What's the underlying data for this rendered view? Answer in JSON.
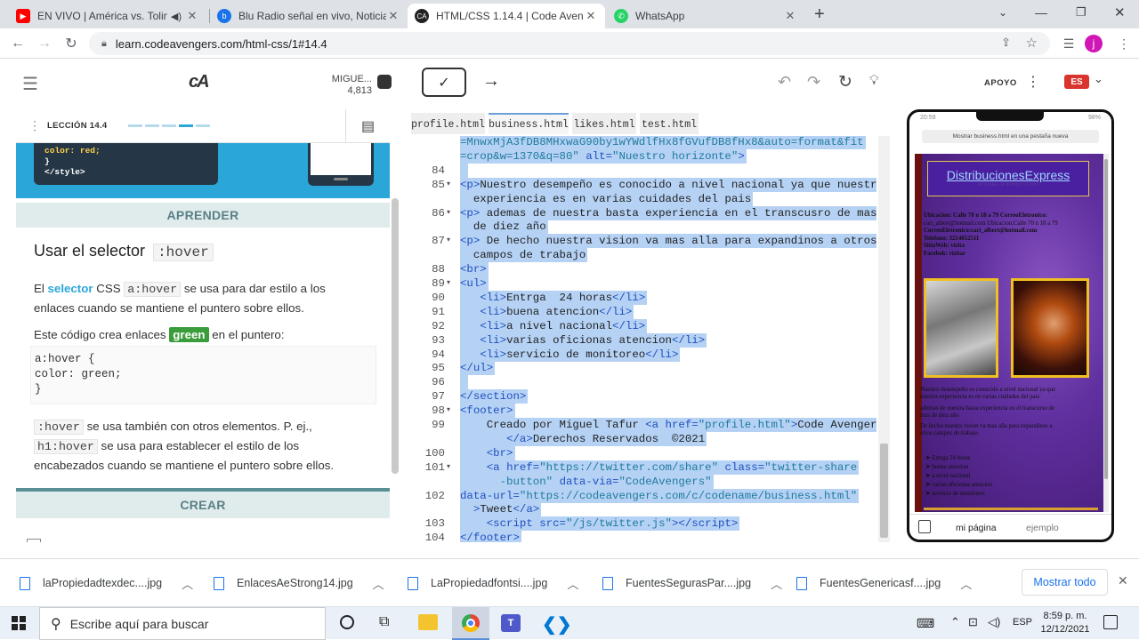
{
  "browser": {
    "tabs": [
      {
        "title": "EN VIVO | América vs. Tolima",
        "favicon": "youtube-icon",
        "color": "#ff0000"
      },
      {
        "title": "Blu Radio señal en vivo, Noticias",
        "favicon": "blu-radio-icon",
        "color": "#1a73e8"
      },
      {
        "title": "HTML/CSS 1.14.4 | Code Avengers",
        "favicon": "code-avengers-icon",
        "color": "#222222"
      },
      {
        "title": "WhatsApp",
        "favicon": "whatsapp-icon",
        "color": "#25d366"
      }
    ],
    "url": "learn.codeavengers.com/html-css/1#14.4",
    "profile_initial": "j"
  },
  "app": {
    "user_name": "MIGUE...",
    "user_points": "4,813",
    "support_label": "APOYO",
    "language": "ES"
  },
  "lesson": {
    "label": "LECCIÓN 14.4",
    "code_preview": [
      "color: red;",
      "}",
      "</style>"
    ],
    "learn_band": "APRENDER",
    "heading_text": "Usar el selector",
    "heading_code": ":hover",
    "p1": {
      "a": "El",
      "link": "selector",
      "b": "CSS",
      "code": "a:hover",
      "c": "se usa para dar estilo a los enlaces cuando se mantiene el puntero sobre ellos."
    },
    "p2": {
      "a": "Este código crea enlaces",
      "badge": "green",
      "b": "en el puntero:"
    },
    "code_block": [
      "a:hover {",
      "  color: green;",
      "}"
    ],
    "p3": {
      "code1": ":hover",
      "a": "se usa también con otros elementos. P. ej.,",
      "code2": "h1:hover",
      "b": "se usa para establecer el estilo de los encabezados cuando se mantiene el puntero sobre ellos."
    },
    "create_band": "CREAR",
    "accent_color": "#2aa6d9",
    "green_color": "#3a9c3a"
  },
  "editor": {
    "files": [
      "profile.html",
      "business.html",
      "likes.html",
      "test.html"
    ],
    "active_file": "business.html",
    "lines": [
      {
        "n": "",
        "f": "",
        "h": "<span class='st'>=MnwxMjA3fDB8MHxwaG90by1wYWdlfHx8fGVufDB8fHx8&auto=format&fit</span>"
      },
      {
        "n": "",
        "f": "",
        "h": "<span class='st'>=crop&w=1370&q=80\"</span> <span class='at'>alt=</span><span class='st'>\"Nuestro horizonte\"</span><span class='tg'>&gt;</span>"
      },
      {
        "n": "84",
        "f": "",
        "h": ""
      },
      {
        "n": "85",
        "f": "▾",
        "h": "<span class='tg'>&lt;p&gt;</span>Nuestro desempeño es conocido a nivel nacional ya que nuestra"
      },
      {
        "n": "",
        "f": "",
        "h": "  experiencia es en varias cuidades del pais"
      },
      {
        "n": "86",
        "f": "▾",
        "h": "<span class='tg'>&lt;p&gt;</span> ademas de nuestra basta experiencia en el transcusro de mas"
      },
      {
        "n": "",
        "f": "",
        "h": "  de diez año"
      },
      {
        "n": "87",
        "f": "▾",
        "h": "<span class='tg'>&lt;p&gt;</span> De hecho nuestra vision va mas alla para expandinos a otros"
      },
      {
        "n": "",
        "f": "",
        "h": "  campos de trabajo"
      },
      {
        "n": "88",
        "f": "",
        "h": "<span class='tg'>&lt;br&gt;</span>"
      },
      {
        "n": "89",
        "f": "▾",
        "h": "<span class='tg'>&lt;ul&gt;</span>"
      },
      {
        "n": "90",
        "f": "",
        "h": "   <span class='tg'>&lt;li&gt;</span>Entrga  24 horas<span class='tg'>&lt;/li&gt;</span>"
      },
      {
        "n": "91",
        "f": "",
        "h": "   <span class='tg'>&lt;li&gt;</span>buena atencion<span class='tg'>&lt;/li&gt;</span>"
      },
      {
        "n": "92",
        "f": "",
        "h": "   <span class='tg'>&lt;li&gt;</span>a nivel nacional<span class='tg'>&lt;/li&gt;</span>"
      },
      {
        "n": "93",
        "f": "",
        "h": "   <span class='tg'>&lt;li&gt;</span>varias oficionas atencion<span class='tg'>&lt;/li&gt;</span>"
      },
      {
        "n": "94",
        "f": "",
        "h": "   <span class='tg'>&lt;li&gt;</span>servicio de monitoreo<span class='tg'>&lt;/li&gt;</span>"
      },
      {
        "n": "95",
        "f": "",
        "h": "<span class='tg'>&lt;/ul&gt;</span>"
      },
      {
        "n": "96",
        "f": "",
        "h": ""
      },
      {
        "n": "97",
        "f": "",
        "h": "<span class='tg'>&lt;/section&gt;</span>"
      },
      {
        "n": "98",
        "f": "▾",
        "h": "<span class='tg'>&lt;footer&gt;</span>"
      },
      {
        "n": "99",
        "f": "",
        "h": "    Creado por Miguel Tafur <span class='tg'>&lt;a</span> <span class='at'>href=</span><span class='st'>\"profile.html\"</span><span class='tg'>&gt;</span>Code Avengers"
      },
      {
        "n": "",
        "f": "",
        "h": "       <span class='tg'>&lt;/a&gt;</span>Derechos Reservados  ©2021"
      },
      {
        "n": "100",
        "f": "",
        "h": "    <span class='tg'>&lt;br&gt;</span>"
      },
      {
        "n": "101",
        "f": "▾",
        "h": "    <span class='tg'>&lt;a</span> <span class='at'>href=</span><span class='st'>\"https://twitter.com/share\"</span> <span class='at'>class=</span><span class='st'>\"twitter-share</span>"
      },
      {
        "n": "",
        "f": "",
        "h": "      <span class='st'>-button\"</span> <span class='at'>data-via=</span><span class='st'>\"CodeAvengers\"</span>"
      },
      {
        "n": "102",
        "f": "",
        "h": "<span class='at'>data-url=</span><span class='st'>\"https://codeavengers.com/c/codename/business.html\"</span>"
      },
      {
        "n": "",
        "f": "",
        "h": "  <span class='tg'>&gt;</span>Tweet<span class='tg'>&lt;/a&gt;</span>"
      },
      {
        "n": "103",
        "f": "",
        "h": "    <span class='tg'>&lt;script</span> <span class='at'>src=</span><span class='st'>\"/js/twitter.js\"</span><span class='tg'>&gt;&lt;/script&gt;</span>"
      },
      {
        "n": "104",
        "f": "",
        "h": "<span class='tg'>&lt;/footer&gt;</span>"
      }
    ]
  },
  "preview": {
    "time": "20:59",
    "battery": "98%",
    "open_tab_label": "Mostrar business.html en una pestaña nueva",
    "site_title": "DistribucionesExpress",
    "site_subtitle": "entregas al tiempo record",
    "contact_lines": [
      "Ubicacion:  Calle  70  n  18  a  79  CorreoEletronico:",
      "cari_albert@hotmail.com Ubicacion:Calle 70 n 18 a 79",
      "CorreoEletronico:cari_albert@hotmail.com",
      "Telefono: 3214052511",
      "SitioWeb: visita",
      "Facebok: visitar"
    ],
    "body_lines": [
      "Nuestro desempeño es conocido a nivel nacional ya que",
      "nuestra experiencia es en varias cuidades del pais",
      "ademas de nuestra basta experiencia en el transcurso de",
      "mas de diez año",
      "De hecho nuestra vision va mas alla para expandinos a",
      "otros campos de trabajo"
    ],
    "list": [
      "Entrga 24 horas",
      "buena atencion",
      "a nivel nacional",
      "varias oficionas atencion",
      "servicio de monitoreo"
    ],
    "footer_tabs": [
      "mi página",
      "ejemplo"
    ]
  },
  "downloads": {
    "files": [
      "laPropiedadtexdec....jpg",
      "EnlacesAeStrong14.jpg",
      "LaPropiedadfontsi....jpg",
      "FuentesSegurasPar....jpg",
      "FuentesGenericasf....jpg"
    ],
    "show_all": "Mostrar todo"
  },
  "taskbar": {
    "search_placeholder": "Escribe aquí para buscar",
    "lang": "ESP",
    "time": "8:59 p. m.",
    "date": "12/12/2021"
  }
}
